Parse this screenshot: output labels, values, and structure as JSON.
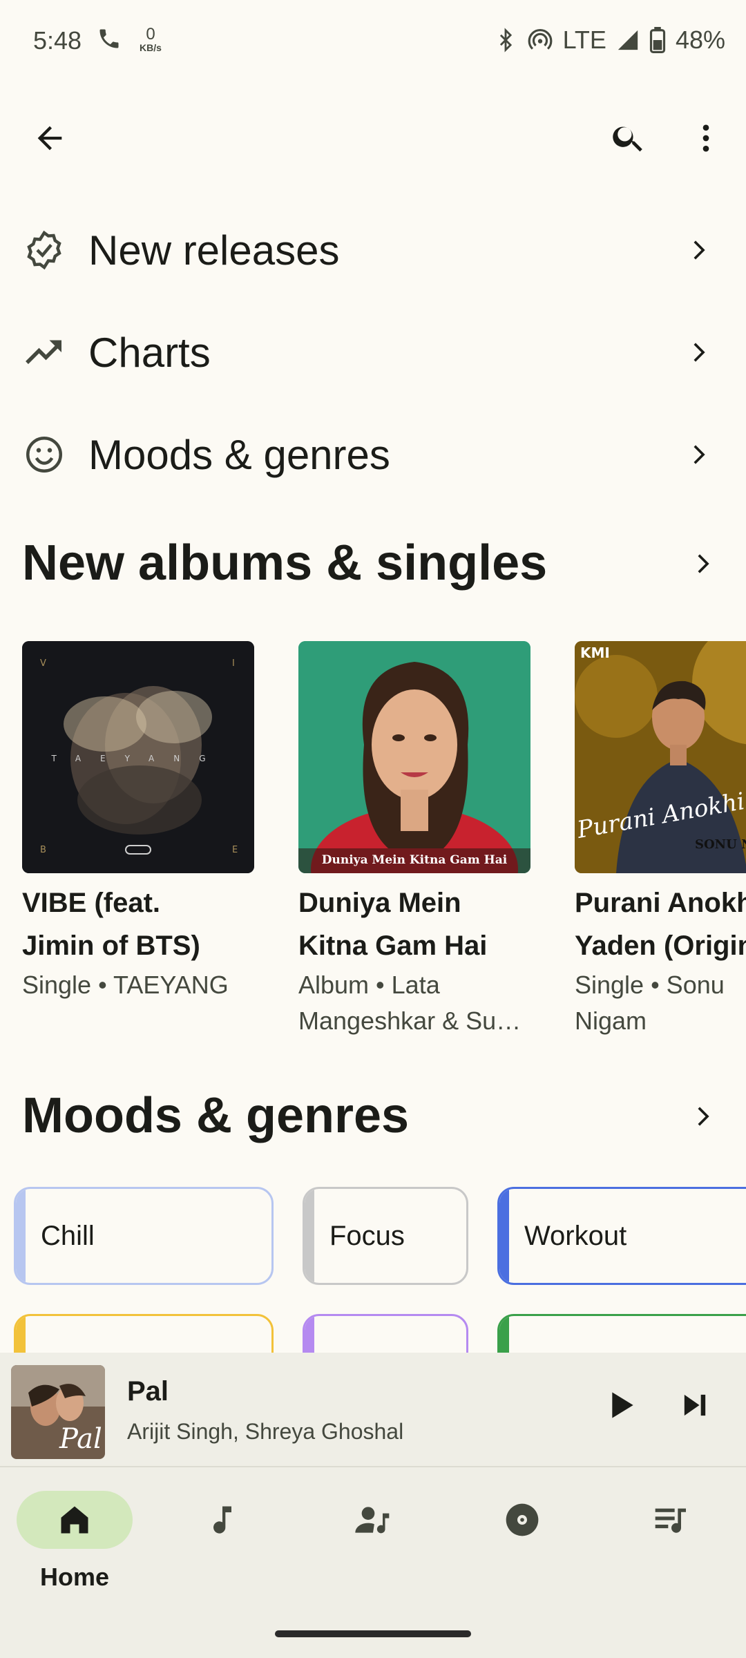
{
  "status_bar": {
    "time": "5:48",
    "net_speed_value": "0",
    "net_speed_unit": "KB/s",
    "network": "LTE",
    "battery": "48%"
  },
  "app_bar": {
    "icons": [
      "back-arrow-icon",
      "search-icon",
      "more-vert-icon"
    ]
  },
  "nav_rows": [
    {
      "label": "New releases",
      "icon": "new-releases-icon"
    },
    {
      "label": "Charts",
      "icon": "trending-up-icon"
    },
    {
      "label": "Moods & genres",
      "icon": "smiley-icon"
    }
  ],
  "sections": {
    "albums_title": "New albums & singles",
    "moods_title": "Moods & genres"
  },
  "albums": [
    {
      "title_line1": "VIBE (feat.",
      "title_line2": "Jimin of BTS)",
      "sub_line1": "Single • TAEYANG",
      "sub_line2": "",
      "art_letters": [
        "V",
        "I",
        "B",
        "E"
      ],
      "art_word": "TAEYANG"
    },
    {
      "title_line1": "Duniya Mein",
      "title_line2": "Kitna Gam Hai",
      "sub_line1": "Album • Lata",
      "sub_line2": "Mangeshkar & Su…",
      "art_caption": "Duniya Mein Kitna Gam Hai"
    },
    {
      "title_line1": "Purani Anokhi",
      "title_line2": "Yaden (Original",
      "sub_line1": "Single • Sonu",
      "sub_line2": "Nigam",
      "art_logo": "KMI",
      "art_caption": "Purani Anokhi",
      "art_caption2": "SONU N"
    }
  ],
  "moods": [
    {
      "label": "Chill",
      "accent": "#b7c6f0",
      "border": "#b7c6f0"
    },
    {
      "label": "Focus",
      "accent": "#c8c8c8",
      "border": "#c8c8c8"
    },
    {
      "label": "Workout",
      "accent": "#4b6fe0",
      "border": "#4b6fe0"
    },
    {
      "label": "",
      "accent": "#f2c23a",
      "border": "#f2c23a"
    },
    {
      "label": "",
      "accent": "#b58af0",
      "border": "#b58af0"
    },
    {
      "label": "",
      "accent": "#3aa04a",
      "border": "#3aa04a"
    }
  ],
  "mini_player": {
    "title": "Pal",
    "artist": "Arijit Singh, Shreya Ghoshal",
    "art_text": "Pal"
  },
  "bottom_nav": {
    "home_label": "Home",
    "items": [
      "home-icon",
      "music-note-icon",
      "artist-icon",
      "album-disc-icon",
      "queue-music-icon"
    ]
  }
}
